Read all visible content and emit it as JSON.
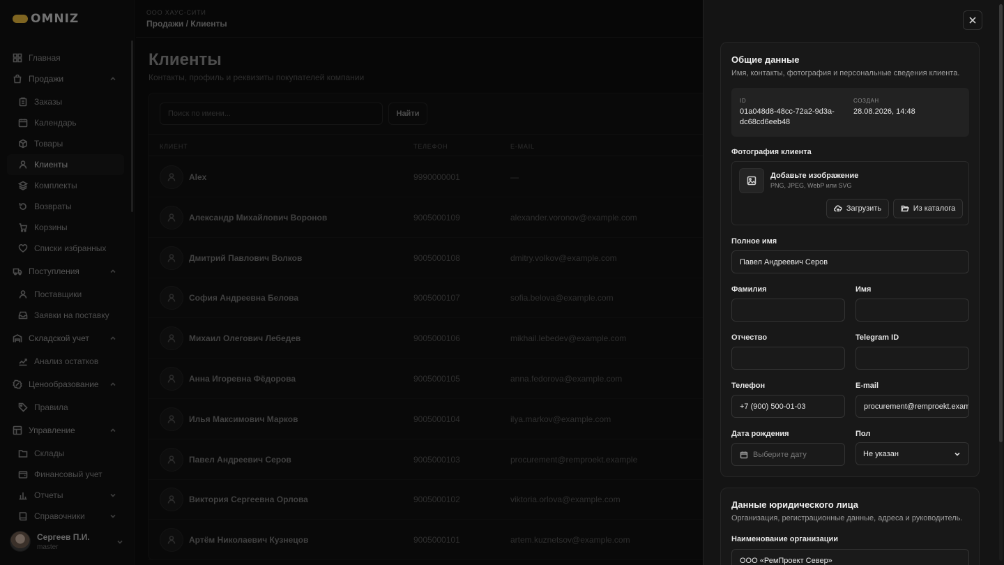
{
  "app": {
    "logo": "OMNIZ",
    "accent": "#e7b83c"
  },
  "sidebar": {
    "items": [
      {
        "label": "Главная",
        "icon": "dashboard-icon",
        "type": "top"
      },
      {
        "label": "Продажи",
        "icon": "shopping-bag-icon",
        "type": "group",
        "expanded": true
      },
      {
        "label": "Заказы",
        "icon": "clipboard-icon",
        "type": "sub"
      },
      {
        "label": "Календарь",
        "icon": "calendar-icon",
        "type": "sub"
      },
      {
        "label": "Товары",
        "icon": "box-icon",
        "type": "sub"
      },
      {
        "label": "Клиенты",
        "icon": "user-icon",
        "type": "sub",
        "active": true
      },
      {
        "label": "Комплекты",
        "icon": "layers-icon",
        "type": "sub"
      },
      {
        "label": "Возвраты",
        "icon": "return-icon",
        "type": "sub"
      },
      {
        "label": "Корзины",
        "icon": "cart-icon",
        "type": "sub"
      },
      {
        "label": "Списки избранных",
        "icon": "heart-icon",
        "type": "sub"
      },
      {
        "label": "Поступления",
        "icon": "truck-icon",
        "type": "group",
        "expanded": true
      },
      {
        "label": "Поставщики",
        "icon": "user-icon",
        "type": "sub"
      },
      {
        "label": "Заявки на поставку",
        "icon": "inbox-icon",
        "type": "sub"
      },
      {
        "label": "Складской учет",
        "icon": "warehouse-icon",
        "type": "group",
        "expanded": true
      },
      {
        "label": "Анализ остатков",
        "icon": "trend-icon",
        "type": "sub"
      },
      {
        "label": "Ценообразование",
        "icon": "percent-icon",
        "type": "group",
        "expanded": true
      },
      {
        "label": "Правила",
        "icon": "tag-icon",
        "type": "sub"
      },
      {
        "label": "Управление",
        "icon": "grid-icon",
        "type": "group",
        "expanded": true
      },
      {
        "label": "Склады",
        "icon": "folder-icon",
        "type": "sub"
      },
      {
        "label": "Финансовый учет",
        "icon": "wallet-icon",
        "type": "sub"
      },
      {
        "label": "Отчеты",
        "icon": "chart-icon",
        "type": "sub",
        "chevron": true
      },
      {
        "label": "Справочники",
        "icon": "book-icon",
        "type": "sub",
        "chevron": true
      }
    ],
    "user": {
      "name": "Сергеев П.И.",
      "role": "master"
    }
  },
  "header": {
    "company": "ООО ХАУС-СИТИ",
    "breadcrumb": "Продажи / Клиенты"
  },
  "page": {
    "title": "Клиенты",
    "subtitle": "Контакты, профиль и реквизиты покупателей компании"
  },
  "toolbar": {
    "search_placeholder": "Поиск по имени...",
    "find_label": "Найти"
  },
  "table": {
    "columns": [
      "КЛИЕНТ",
      "ТЕЛЕФОН",
      "E-MAIL"
    ],
    "rows": [
      {
        "name": "Alex",
        "phone": "9990000001",
        "email": "—"
      },
      {
        "name": "Александр Михайлович Воронов",
        "phone": "9005000109",
        "email": "alexander.voronov@example.com"
      },
      {
        "name": "Дмитрий Павлович Волков",
        "phone": "9005000108",
        "email": "dmitry.volkov@example.com"
      },
      {
        "name": "София Андреевна Белова",
        "phone": "9005000107",
        "email": "sofia.belova@example.com"
      },
      {
        "name": "Михаил Олегович Лебедев",
        "phone": "9005000106",
        "email": "mikhail.lebedev@example.com"
      },
      {
        "name": "Анна Игоревна Фёдорова",
        "phone": "9005000105",
        "email": "anna.fedorova@example.com"
      },
      {
        "name": "Илья Максимович Марков",
        "phone": "9005000104",
        "email": "ilya.markov@example.com"
      },
      {
        "name": "Павел Андреевич Серов",
        "phone": "9005000103",
        "email": "procurement@remproekt.example"
      },
      {
        "name": "Виктория Сергеевна Орлова",
        "phone": "9005000102",
        "email": "viktoria.orlova@example.com"
      },
      {
        "name": "Артём Николаевич Кузнецов",
        "phone": "9005000101",
        "email": "artem.kuznetsov@example.com"
      }
    ]
  },
  "drawer": {
    "general": {
      "title": "Общие данные",
      "description": "Имя, контакты, фотография и персональные сведения клиента.",
      "id_label": "ID",
      "id_value": "01a048d8-48cc-72a2-9d3a-dc68cd6eeb48",
      "created_label": "СОЗДАН",
      "created_value": "28.08.2026, 14:48",
      "photo_label": "Фотография клиента",
      "photo_title": "Добавьте изображение",
      "photo_hint": "PNG, JPEG, WebP или SVG",
      "upload_label": "Загрузить",
      "catalog_label": "Из каталога",
      "full_name_label": "Полное имя",
      "full_name_value": "Павел Андреевич Серов",
      "last_name_label": "Фамилия",
      "last_name_value": "",
      "first_name_label": "Имя",
      "first_name_value": "",
      "middle_name_label": "Отчество",
      "middle_name_value": "",
      "telegram_label": "Telegram ID",
      "telegram_value": "",
      "phone_label": "Телефон",
      "phone_value": "+7 (900) 500-01-03",
      "email_label": "E-mail",
      "email_value": "procurement@remproekt.example",
      "birth_label": "Дата рождения",
      "birth_placeholder": "Выберите дату",
      "gender_label": "Пол",
      "gender_value": "Не указан"
    },
    "legal": {
      "title": "Данные юридического лица",
      "description": "Организация, регистрационные данные, адреса и руководитель.",
      "org_label": "Наименование организации",
      "org_value": "ООО «РемПроект Север»"
    }
  }
}
